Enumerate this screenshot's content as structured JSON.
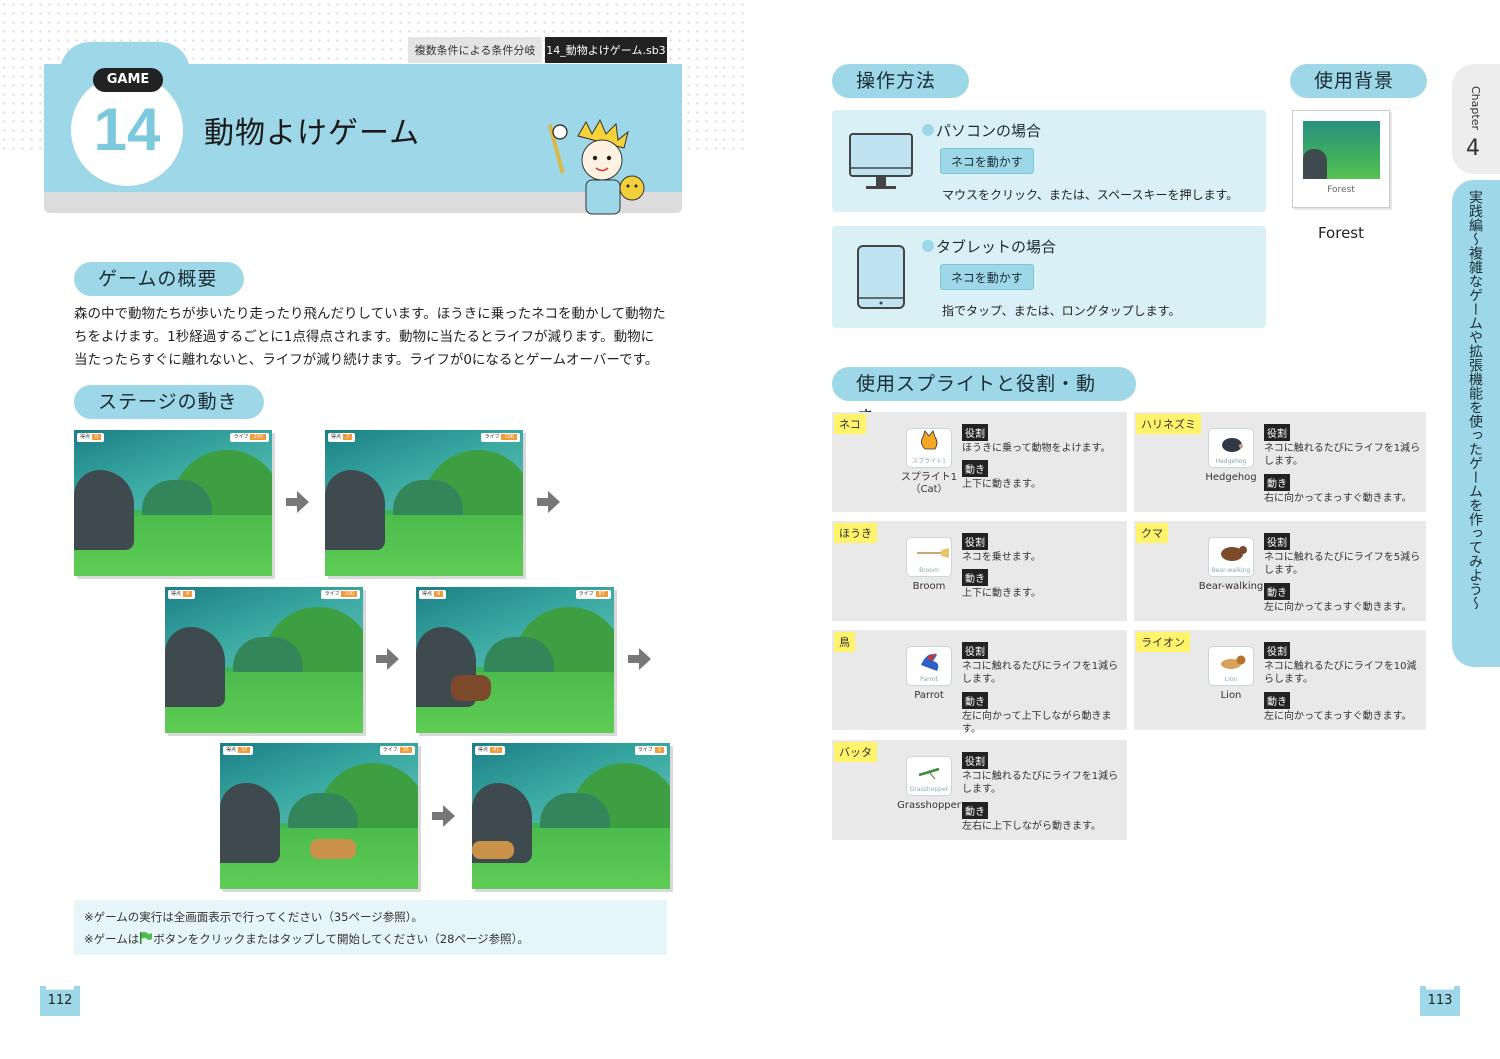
{
  "header": {
    "game_label": "GAME",
    "game_number": "14",
    "title": "動物よけゲーム",
    "topic_tag": "複数条件による条件分岐",
    "file_tag": "14_動物よけゲーム.sb3"
  },
  "overview": {
    "heading": "ゲームの概要",
    "lines": [
      "森の中で動物たちが歩いたり走ったり飛んだりしています。ほうきに乗ったネコを動かして動物た",
      "ちをよけます。1秒経過するごとに1点得点されます。動物に当たるとライフが減ります。動物に",
      "当たったらすぐに離れないと、ライフが減り続けます。ライフが0になるとゲームオーバーです。"
    ]
  },
  "stage": {
    "heading": "ステージの動き",
    "frames": [
      {
        "score_label": "得点",
        "score": "0",
        "life_label": "ライフ",
        "life": "100"
      },
      {
        "score_label": "得点",
        "score": "2",
        "life_label": "ライフ",
        "life": "100"
      },
      {
        "score_label": "得点",
        "score": "4",
        "life_label": "ライフ",
        "life": "100"
      },
      {
        "score_label": "得点",
        "score": "9",
        "life_label": "ライフ",
        "life": "87"
      },
      {
        "score_label": "得点",
        "score": "32",
        "life_label": "ライフ",
        "life": "35"
      },
      {
        "score_label": "得点",
        "score": "41",
        "life_label": "ライフ",
        "life": "1"
      }
    ]
  },
  "notes": {
    "line1": "※ゲームの実行は全画面表示で行ってください（35ページ参照）。",
    "line2_a": "※ゲームは",
    "line2_b": "ボタンをクリックまたはタップして開始してください（28ページ参照）。"
  },
  "controls": {
    "heading": "操作方法",
    "pc": {
      "title": "パソコンの場合",
      "button": "ネコを動かす",
      "desc": "マウスをクリック、または、スペースキーを押します。"
    },
    "tablet": {
      "title": "タブレットの場合",
      "button": "ネコを動かす",
      "desc": "指でタップ、または、ロングタップします。"
    }
  },
  "background": {
    "heading": "使用背景",
    "thumb_label": "Forest",
    "name": "Forest"
  },
  "sprites": {
    "heading": "使用スプライトと役割・動き",
    "role_label": "役割",
    "move_label": "動き",
    "items": [
      {
        "name": "ネコ",
        "thumb": "スプライト1",
        "sprite": "スプライト1\n（Cat）",
        "role": "ほうきに乗って動物をよけます。",
        "move": "上下に動きます。"
      },
      {
        "name": "ハリネズミ",
        "thumb": "Hedgehog",
        "sprite": "Hedgehog",
        "role": "ネコに触れるたびにライフを1減らします。",
        "move": "右に向かってまっすぐ動きます。"
      },
      {
        "name": "ほうき",
        "thumb": "Broom",
        "sprite": "Broom",
        "role": "ネコを乗せます。",
        "move": "上下に動きます。"
      },
      {
        "name": "クマ",
        "thumb": "Bear-walking",
        "sprite": "Bear-walking",
        "role": "ネコに触れるたびにライフを5減らします。",
        "move": "左に向かってまっすぐ動きます。"
      },
      {
        "name": "鳥",
        "thumb": "Parrot",
        "sprite": "Parrot",
        "role": "ネコに触れるたびにライフを1減らします。",
        "move": "左に向かって上下しながら動きます。"
      },
      {
        "name": "ライオン",
        "thumb": "Lion",
        "sprite": "Lion",
        "role": "ネコに触れるたびにライフを10減らします。",
        "move": "左に向かってまっすぐ動きます。"
      },
      {
        "name": "バッタ",
        "thumb": "Grasshopper",
        "sprite": "Grasshopper",
        "role": "ネコに触れるたびにライフを1減らします。",
        "move": "左右に上下しながら動きます。"
      }
    ]
  },
  "side": {
    "chapter_label": "Chapter",
    "chapter_number": "4",
    "section_title": "実践編〜複雑なゲームや拡張機能を使ったゲームを作ってみよう〜"
  },
  "pages": {
    "left": "112",
    "right": "113"
  },
  "colors": {
    "accent_blue": "#9ed8e8",
    "panel_blue": "#d9f0f7",
    "name_yellow": "#fff36b",
    "score_orange": "#f29b38"
  }
}
